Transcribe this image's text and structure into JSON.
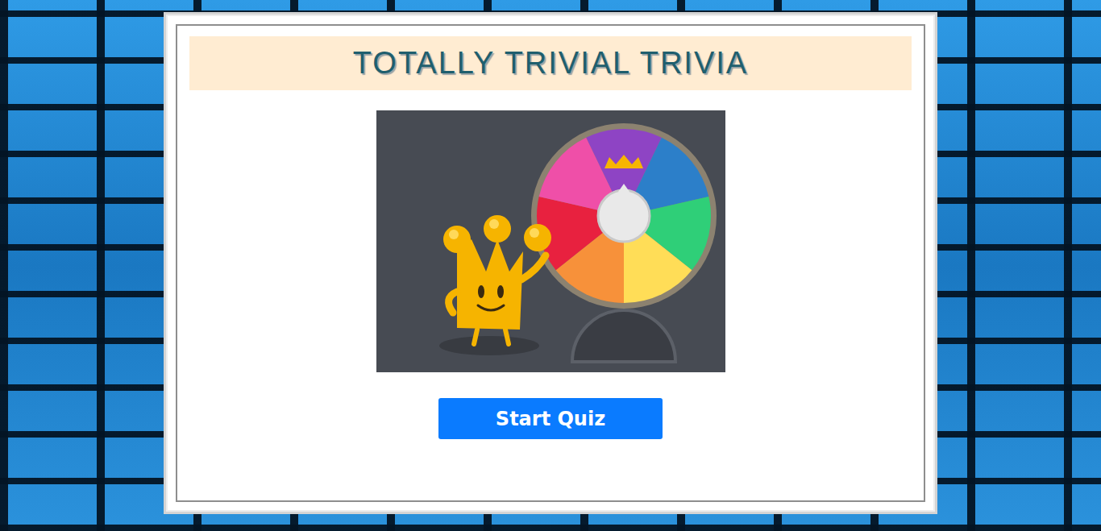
{
  "header": {
    "title": "TOTALLY TRIVIAL TRIVIA"
  },
  "start_button": {
    "label": "Start Quiz"
  }
}
